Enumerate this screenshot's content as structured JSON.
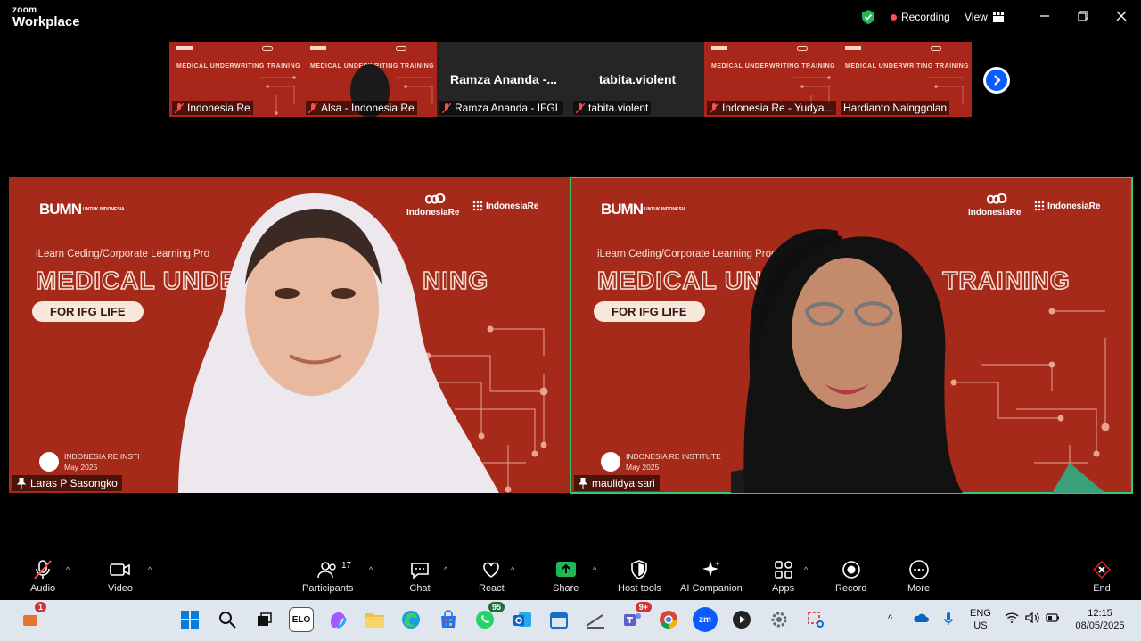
{
  "app": {
    "brand_small": "zoom",
    "brand_large": "Workplace"
  },
  "header": {
    "recording_label": "Recording",
    "view_label": "View"
  },
  "strip": [
    {
      "name": "Indonesia Re",
      "type": "slide",
      "slide_title": "MEDICAL UNDERWRITING TRAINING"
    },
    {
      "name": "Alsa - Indonesia Re",
      "type": "slide",
      "slide_title": "MEDICAL UNDERWRITING TRAINING"
    },
    {
      "name": "Ramza Ananda - IFGL",
      "type": "name",
      "display": "Ramza Ananda -..."
    },
    {
      "name": "tabita.violent",
      "type": "name",
      "display": "tabita.violent"
    },
    {
      "name": "Indonesia Re - Yudya...",
      "type": "slide",
      "slide_title": "MEDICAL UNDERWRITING TRAINING"
    },
    {
      "name": "Hardianto Nainggolan",
      "type": "slide",
      "slide_title": "MEDICAL UNDERWRITING TRAINING"
    }
  ],
  "tiles": [
    {
      "name": "Laras P Sasongko",
      "bumn": "BUMN",
      "bumn_sub": "UNTUK INDONESIA",
      "ir_logo": "IndonesiaRe",
      "iri_logo": "IndonesiaRe",
      "program": "iLearn Ceding/Corporate Learning Pro",
      "title": "MEDICAL UNDE",
      "title2": "NING",
      "pill": "FOR IFG LIFE",
      "foot1": "INDONESIA RE INSTI",
      "foot2": "May 2025"
    },
    {
      "name": "maulidya sari",
      "bumn": "BUMN",
      "bumn_sub": "UNTUK INDONESIA",
      "ir_logo": "IndonesiaRe",
      "iri_logo": "IndonesiaRe",
      "program": "iLearn Ceding/Corporate Learning Program",
      "title": "MEDICAL UNDER",
      "title2": "TRAINING",
      "pill": "FOR IFG LIFE",
      "foot1": "INDONESIA RE INSTITUTE",
      "foot2": "May 2025"
    }
  ],
  "toolbar": {
    "audio": "Audio",
    "video": "Video",
    "participants": "Participants",
    "participants_count": "17",
    "chat": "Chat",
    "react": "React",
    "share": "Share",
    "host_tools": "Host tools",
    "ai_companion": "AI Companion",
    "apps": "Apps",
    "record": "Record",
    "more": "More",
    "end": "End"
  },
  "taskbar": {
    "notif_badge": "1",
    "whatsapp_badge": "95",
    "teams_badge": "9+",
    "lang1": "ENG",
    "lang2": "US",
    "time": "12:15",
    "date": "08/05/2025",
    "elo": "ELO",
    "zm": "zm"
  },
  "colors": {
    "slide_red": "#a52a1a",
    "active_border": "#2ecc71",
    "zoom_blue": "#0b5cff",
    "end_red": "#e02828"
  }
}
